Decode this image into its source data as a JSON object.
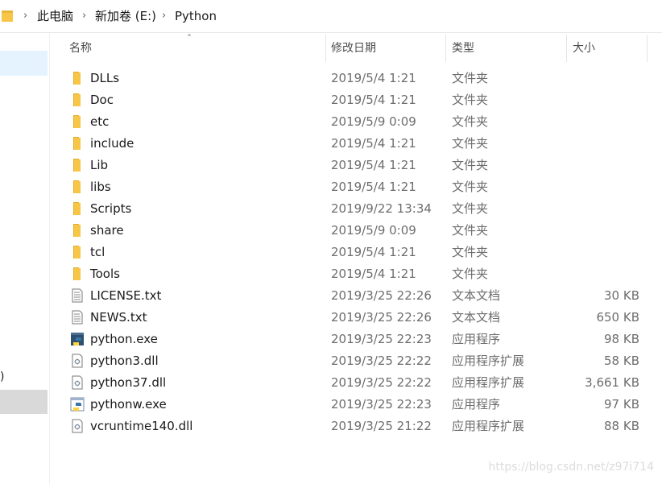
{
  "breadcrumb": {
    "items": [
      "此电脑",
      "新加卷 (E:)",
      "Python"
    ]
  },
  "nav": {
    "partial_text": ")"
  },
  "columns": {
    "name": "名称",
    "date": "修改日期",
    "type": "类型",
    "size": "大小"
  },
  "files": [
    {
      "name": "DLLs",
      "date": "2019/5/4 1:21",
      "type": "文件夹",
      "size": "",
      "icon": "folder-icon"
    },
    {
      "name": "Doc",
      "date": "2019/5/4 1:21",
      "type": "文件夹",
      "size": "",
      "icon": "folder-icon"
    },
    {
      "name": "etc",
      "date": "2019/5/9 0:09",
      "type": "文件夹",
      "size": "",
      "icon": "folder-icon"
    },
    {
      "name": "include",
      "date": "2019/5/4 1:21",
      "type": "文件夹",
      "size": "",
      "icon": "folder-icon"
    },
    {
      "name": "Lib",
      "date": "2019/5/4 1:21",
      "type": "文件夹",
      "size": "",
      "icon": "folder-icon"
    },
    {
      "name": "libs",
      "date": "2019/5/4 1:21",
      "type": "文件夹",
      "size": "",
      "icon": "folder-icon"
    },
    {
      "name": "Scripts",
      "date": "2019/9/22 13:34",
      "type": "文件夹",
      "size": "",
      "icon": "folder-icon"
    },
    {
      "name": "share",
      "date": "2019/5/9 0:09",
      "type": "文件夹",
      "size": "",
      "icon": "folder-icon"
    },
    {
      "name": "tcl",
      "date": "2019/5/4 1:21",
      "type": "文件夹",
      "size": "",
      "icon": "folder-icon"
    },
    {
      "name": "Tools",
      "date": "2019/5/4 1:21",
      "type": "文件夹",
      "size": "",
      "icon": "folder-icon"
    },
    {
      "name": "LICENSE.txt",
      "date": "2019/3/25 22:26",
      "type": "文本文档",
      "size": "30 KB",
      "icon": "text-file-icon"
    },
    {
      "name": "NEWS.txt",
      "date": "2019/3/25 22:26",
      "type": "文本文档",
      "size": "650 KB",
      "icon": "text-file-icon"
    },
    {
      "name": "python.exe",
      "date": "2019/3/25 22:23",
      "type": "应用程序",
      "size": "98 KB",
      "icon": "python-exe-icon"
    },
    {
      "name": "python3.dll",
      "date": "2019/3/25 22:22",
      "type": "应用程序扩展",
      "size": "58 KB",
      "icon": "dll-file-icon"
    },
    {
      "name": "python37.dll",
      "date": "2019/3/25 22:22",
      "type": "应用程序扩展",
      "size": "3,661 KB",
      "icon": "dll-file-icon"
    },
    {
      "name": "pythonw.exe",
      "date": "2019/3/25 22:23",
      "type": "应用程序",
      "size": "97 KB",
      "icon": "pythonw-exe-icon"
    },
    {
      "name": "vcruntime140.dll",
      "date": "2019/3/25 21:22",
      "type": "应用程序扩展",
      "size": "88 KB",
      "icon": "dll-file-icon"
    }
  ],
  "watermark": "https://blog.csdn.net/z97i714",
  "colors": {
    "folder": "#f8c646",
    "nav_selected": "#e5f3ff",
    "nav_selected_inactive": "#d9d9d9"
  }
}
